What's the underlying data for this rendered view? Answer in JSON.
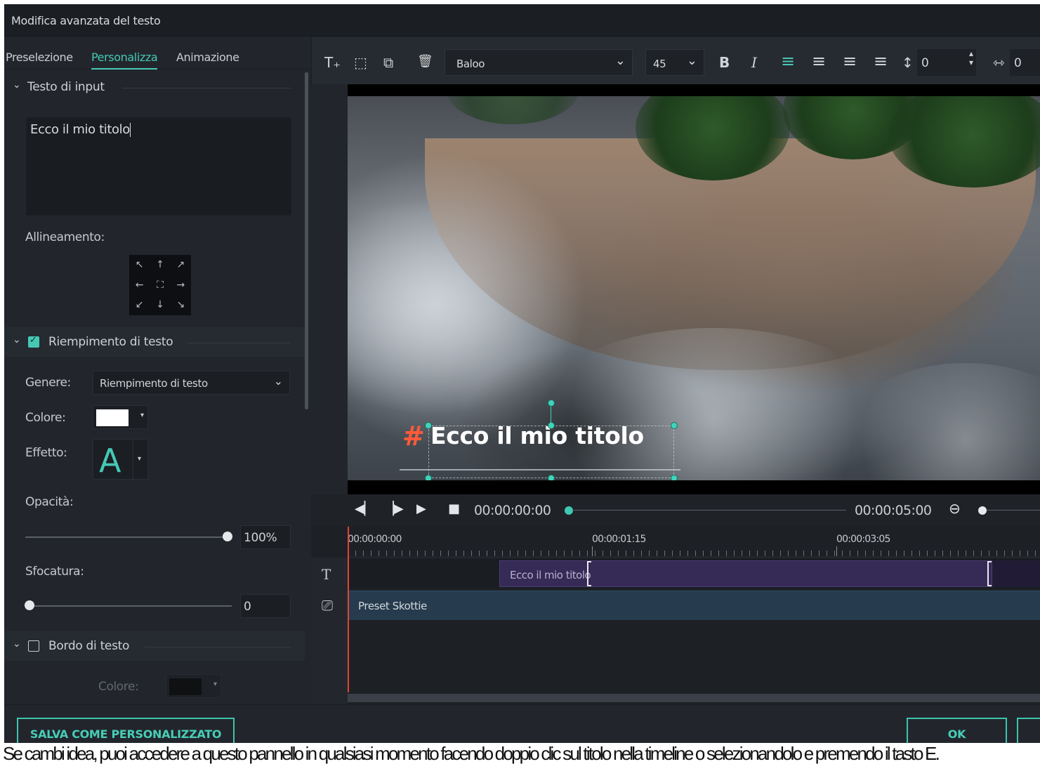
{
  "window": {
    "title": "Modifica avanzata del testo"
  },
  "tabs": [
    {
      "label": "Preselezione",
      "active": false
    },
    {
      "label": "Personalizza",
      "active": true
    },
    {
      "label": "Animazione",
      "active": false
    }
  ],
  "input_section": {
    "label": "Testo di input",
    "text_value": "Ecco il mio titolo"
  },
  "alignment": {
    "label": "Allineamento:",
    "grid": [
      "↖",
      "↑",
      "↗",
      "←",
      "⛶",
      "→",
      "↙",
      "↓",
      "↘"
    ]
  },
  "fill_section": {
    "label": "Riempimento di testo",
    "checked": true,
    "genre_label": "Genere:",
    "genre_value": "Riempimento di testo",
    "color_label": "Colore:",
    "color_value": "#ffffff",
    "effect_label": "Effetto:",
    "effect_glyph": "A",
    "opacity_label": "Opacità:",
    "opacity_value": "100%",
    "opacity_fraction": 1.0,
    "blur_label": "Sfocatura:",
    "blur_value": "0",
    "blur_fraction": 0.0
  },
  "border_section": {
    "label": "Bordo di testo",
    "checked": false,
    "color_label": "Colore:",
    "color_value": "#000000"
  },
  "toolbar": {
    "icons": [
      "add-text-icon",
      "crop-icon",
      "layers-icon",
      "trash-icon"
    ],
    "icon_glyphs": [
      "T₊",
      "⬚",
      "⧉",
      "🗑"
    ],
    "font_value": "Baloo",
    "size_value": "45",
    "bold_glyph": "B",
    "italic_glyph": "I",
    "align_glyphs": [
      "≡",
      "≡",
      "≡",
      "≡"
    ],
    "line_spacing_glyph": "↕",
    "line_spacing_value": "0",
    "char_spacing_glyph": "⇿",
    "char_spacing_value": "0"
  },
  "preview": {
    "title_text": "Ecco il mio titolo",
    "title_color": "#ffffff",
    "accent_color": "#ff5a3a"
  },
  "transport": {
    "current_time": "00:00:00:00",
    "total_time": "00:00:05:00"
  },
  "timeline": {
    "ruler_labels": [
      "00:00:00:00",
      "00:00:01:15",
      "00:00:03:05"
    ],
    "text_clip_label": "Ecco il mio titolo",
    "preset_label": "Preset Skottie"
  },
  "footer": {
    "save_custom_label": "SALVA COME PERSONALIZZATO",
    "ok_label": "OK"
  },
  "caption": "Se cambi idea, puoi accedere a questo pannello in qualsiasi momento facendo doppio clic sul titolo nella timeline o selezionandolo e premendo il tasto E."
}
